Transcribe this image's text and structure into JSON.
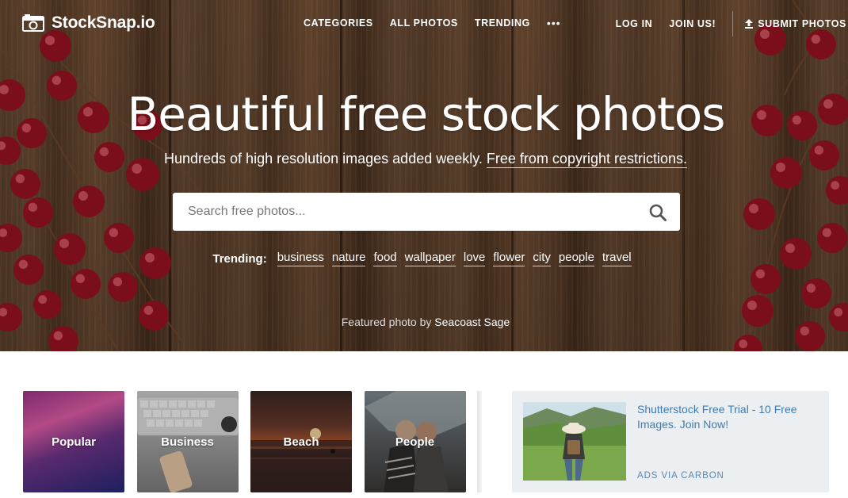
{
  "header": {
    "logo_text": "StockSnap.io",
    "nav_left": [
      "CATEGORIES",
      "ALL PHOTOS",
      "TRENDING"
    ],
    "more_icon": "•••",
    "login": "LOG IN",
    "join": "JOIN US!",
    "submit": "SUBMIT PHOTOS"
  },
  "hero": {
    "title": "Beautiful free stock photos",
    "subtitle": "Hundreds of high resolution images added weekly.",
    "subtitle_link": "Free from copyright restrictions.",
    "search_placeholder": "Search free photos...",
    "trending_label": "Trending:",
    "trending_tags": [
      "business",
      "nature",
      "food",
      "wallpaper",
      "love",
      "flower",
      "city",
      "people",
      "travel"
    ],
    "featured_prefix": "Featured photo by",
    "featured_author": "Seacoast Sage"
  },
  "categories": [
    {
      "label": "Popular"
    },
    {
      "label": "Business"
    },
    {
      "label": "Beach"
    },
    {
      "label": "People"
    }
  ],
  "ad": {
    "text": "Shutterstock Free Trial - 10 Free Images. Join Now!",
    "via": "ADS VIA CARBON"
  },
  "icons": {
    "logo": "camera-icon",
    "search": "search-icon",
    "upload": "upload-icon",
    "more": "more-dots-icon"
  },
  "colors": {
    "ad_link": "#3d7bb0",
    "ad_background": "#eceff1"
  }
}
